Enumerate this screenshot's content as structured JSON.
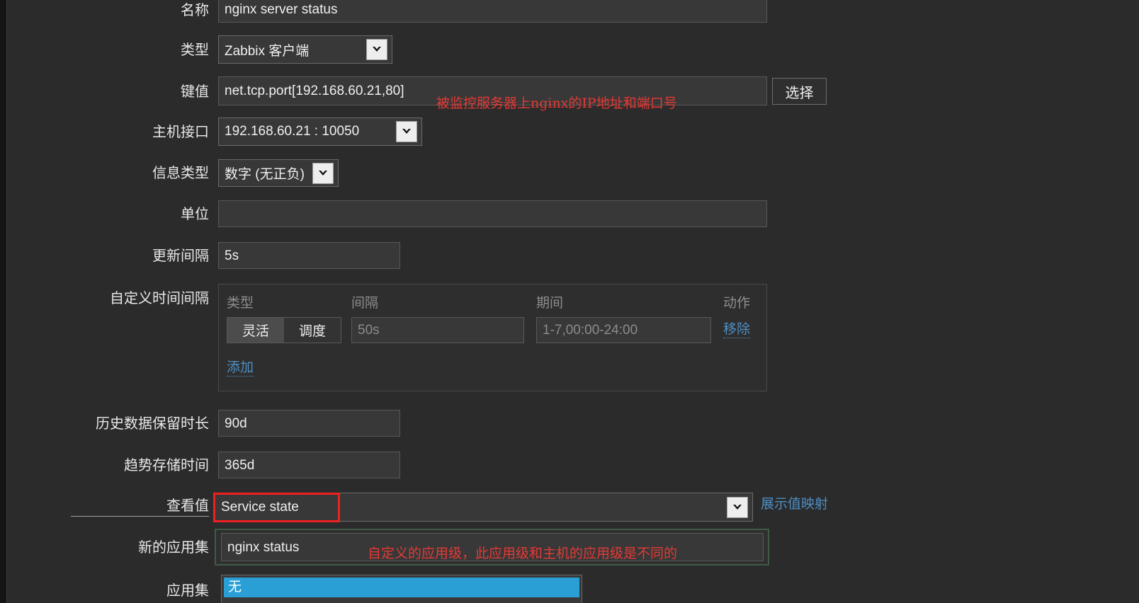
{
  "theme": {
    "background": "#2b2b2b",
    "field_bg": "#383838",
    "field_border": "#585858",
    "text": "#e8e8e8",
    "link_blue": "#4e8fc4",
    "annotation_red": "#e53935",
    "highlight_red": "#f02020",
    "highlight_green": "#3f5b45",
    "selected_blue": "#2a9fd6"
  },
  "form": {
    "name": {
      "label": "名称",
      "value": "nginx server status"
    },
    "type": {
      "label": "类型",
      "value": "Zabbix 客户端",
      "icon": "chevron-down-icon"
    },
    "key": {
      "label": "键值",
      "value": "net.tcp.port[192.168.60.21,80]",
      "select_button": "选择",
      "annotation": "被监控服务器上nginx的IP地址和端口号"
    },
    "host_interface": {
      "label": "主机接口",
      "value": "192.168.60.21 : 10050",
      "icon": "chevron-down-icon"
    },
    "info_type": {
      "label": "信息类型",
      "value": "数字 (无正负)",
      "icon": "chevron-down-icon"
    },
    "units": {
      "label": "单位",
      "value": ""
    },
    "update_interval": {
      "label": "更新间隔",
      "value": "5s"
    },
    "custom_intervals": {
      "label": "自定义时间间隔",
      "columns": [
        "类型",
        "间隔",
        "期间",
        "动作"
      ],
      "rows": [
        {
          "type_options": [
            "灵活",
            "调度"
          ],
          "type_selected": "灵活",
          "interval": "50s",
          "period": "1-7,00:00-24:00",
          "action": "移除"
        }
      ],
      "add_label": "添加"
    },
    "history": {
      "label": "历史数据保留时长",
      "value": "90d"
    },
    "trends": {
      "label": "趋势存储时间",
      "value": "365d"
    },
    "value_map": {
      "label": "查看值",
      "value": "Service state",
      "icon": "chevron-down-icon",
      "link": "展示值映射"
    },
    "new_application": {
      "label": "新的应用集",
      "value": "nginx status",
      "annotation": "自定义的应用级，此应用级和主机的应用级是不同的"
    },
    "applications": {
      "label": "应用集",
      "options": [
        "无"
      ],
      "selected": "无"
    }
  }
}
